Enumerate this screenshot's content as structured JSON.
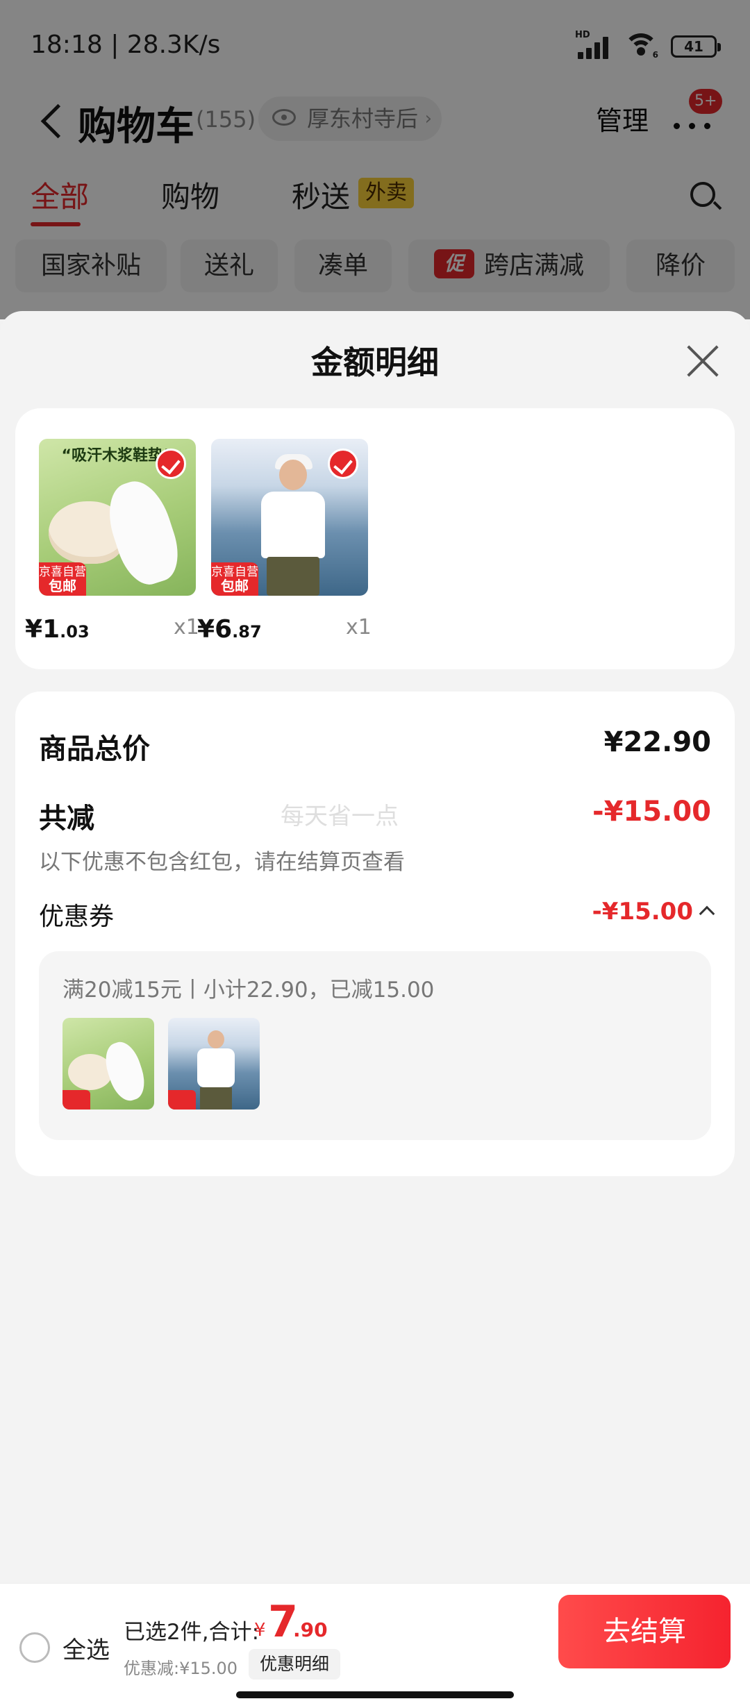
{
  "status_bar": {
    "time": "18:18 | 28.3K/s",
    "signal_label": "HD",
    "wifi_label": "6",
    "battery": "41"
  },
  "header": {
    "title": "购物车",
    "count": "(155)",
    "address": "厚东村寺后",
    "manage_label": "管理",
    "more_badge": "5+"
  },
  "tabs": [
    {
      "label": "全部",
      "active": true
    },
    {
      "label": "购物",
      "active": false
    },
    {
      "label": "秒送",
      "active": false,
      "badge": "外卖"
    }
  ],
  "filter_chips": [
    "国家补贴",
    "送礼",
    "凑单",
    "跨店满减",
    "降价"
  ],
  "promo_badge": "促",
  "sheet": {
    "title": "金额明细",
    "products": [
      {
        "image_title": "“吸汗木浆鞋垫”",
        "tag_line1": "京喜自营",
        "tag_line2": "包邮",
        "price_symbol": "¥",
        "price_int": "1",
        "price_dec": ".03",
        "qty": "x1"
      },
      {
        "image_title": "",
        "tag_line1": "京喜自营",
        "tag_line2": "包邮",
        "price_symbol": "¥",
        "price_int": "6",
        "price_dec": ".87",
        "qty": "x1"
      }
    ],
    "total_label": "商品总价",
    "total_value": "¥22.90",
    "discount_label": "共减",
    "discount_value": "-¥15.00",
    "discount_note": "以下优惠不包含红包，请在结算页查看",
    "watermark": "每天省一点",
    "coupon_label": "优惠券",
    "coupon_value": "-¥15.00",
    "coupon_desc": "满20减15元丨小计22.90，已减15.00"
  },
  "bottom_bar": {
    "select_all": "全选",
    "summary": "已选2件,合计:",
    "total_symbol": "¥",
    "total_int": "7",
    "total_dec": ".90",
    "saved": "优惠减:¥15.00",
    "detail_button": "优惠明细",
    "checkout": "去结算"
  },
  "colors": {
    "accent": "#e5282b",
    "takeout_badge": "#fbd13a",
    "sheet_bg": "#f3f3f3"
  }
}
